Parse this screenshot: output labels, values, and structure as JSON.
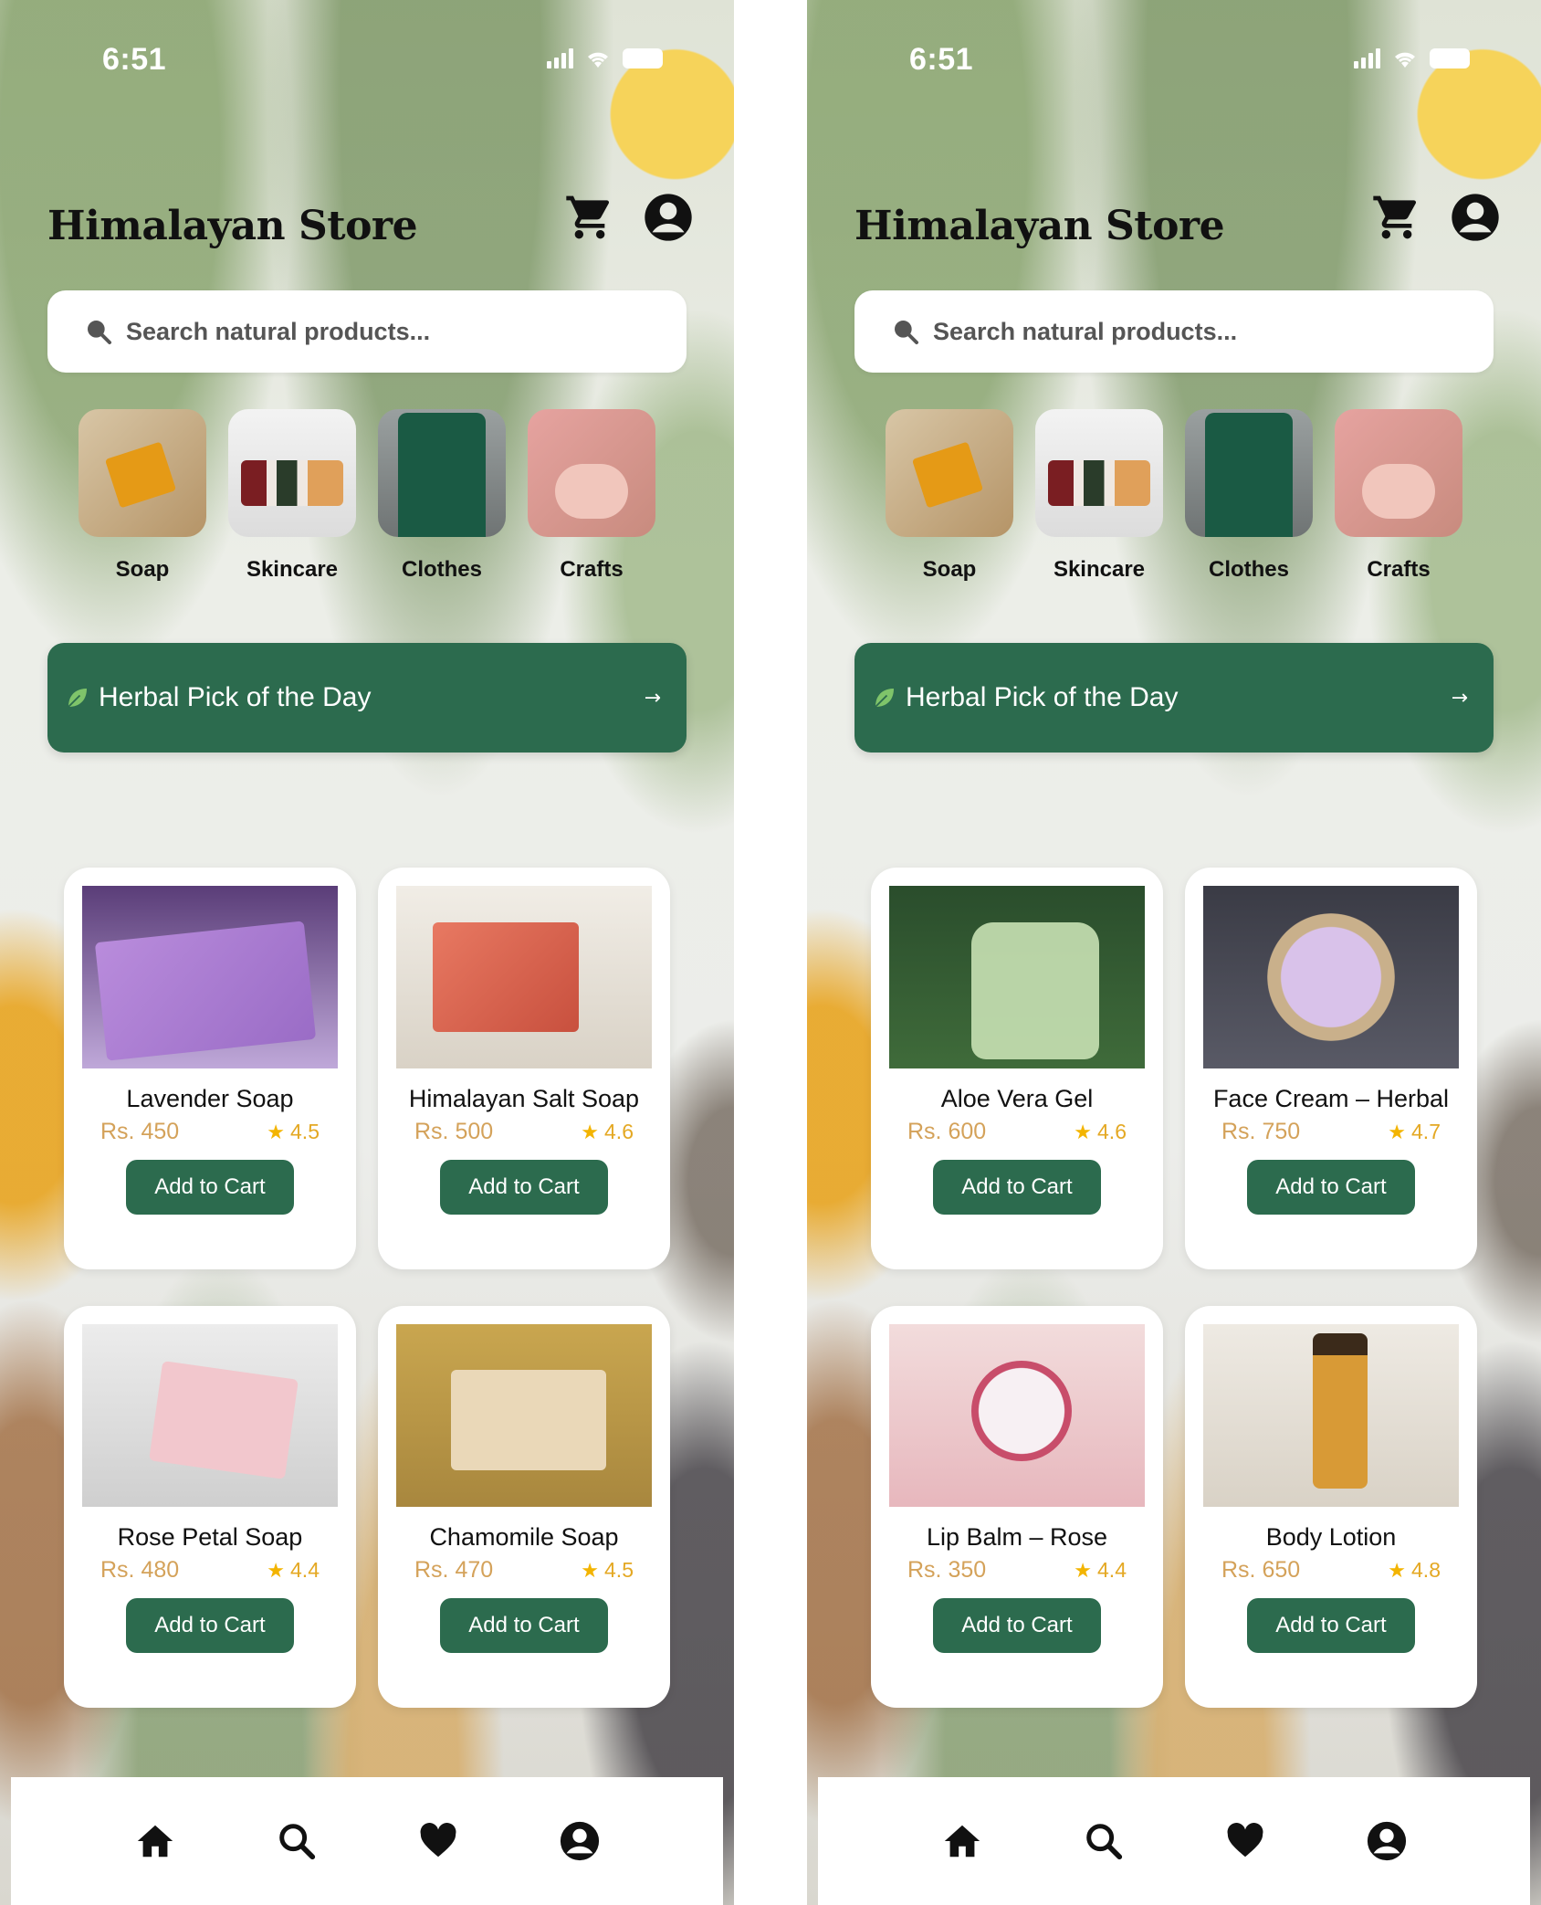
{
  "screens": [
    {
      "status": {
        "time": "6:51"
      },
      "header": {
        "title": "Himalayan Store"
      },
      "search": {
        "placeholder": "Search natural products..."
      },
      "categories": [
        {
          "label": "Soap"
        },
        {
          "label": "Skincare"
        },
        {
          "label": "Clothes"
        },
        {
          "label": "Crafts"
        }
      ],
      "pick_banner": {
        "label": "Herbal Pick of the Day",
        "arrow": "→"
      },
      "products": [
        {
          "name": "Lavender Soap",
          "price": "Rs. 450",
          "rating": "4.5",
          "button": "Add to Cart"
        },
        {
          "name": "Himalayan Salt Soap",
          "price": "Rs. 500",
          "rating": "4.6",
          "button": "Add to Cart"
        },
        {
          "name": "Rose Petal Soap",
          "price": "Rs. 480",
          "rating": "4.4",
          "button": "Add to Cart"
        },
        {
          "name": "Chamomile Soap",
          "price": "Rs. 470",
          "rating": "4.5",
          "button": "Add to Cart"
        }
      ]
    },
    {
      "status": {
        "time": "6:51"
      },
      "header": {
        "title": "Himalayan Store"
      },
      "search": {
        "placeholder": "Search natural products..."
      },
      "categories": [
        {
          "label": "Soap"
        },
        {
          "label": "Skincare"
        },
        {
          "label": "Clothes"
        },
        {
          "label": "Crafts"
        }
      ],
      "pick_banner": {
        "label": "Herbal Pick of the Day",
        "arrow": "→"
      },
      "products": [
        {
          "name": "Aloe Vera Gel",
          "price": "Rs. 600",
          "rating": "4.6",
          "button": "Add to Cart"
        },
        {
          "name": "Face Cream – Herbal",
          "price": "Rs. 750",
          "rating": "4.7",
          "button": "Add to Cart"
        },
        {
          "name": "Lip Balm – Rose",
          "price": "Rs. 350",
          "rating": "4.4",
          "button": "Add to Cart"
        },
        {
          "name": "Body Lotion",
          "price": "Rs. 650",
          "rating": "4.8",
          "button": "Add to Cart"
        }
      ]
    }
  ],
  "icons": {
    "status": [
      "signal-icon",
      "wifi-icon",
      "battery-icon"
    ],
    "header": [
      "cart-icon",
      "account-icon"
    ],
    "search": "search-icon",
    "banner": "leaf-icon",
    "rating": "star-icon",
    "bottom_nav": [
      "home-icon",
      "search-icon",
      "heart-icon",
      "profile-icon"
    ]
  },
  "colors": {
    "primary_green": "#2c6b4e",
    "price_tan": "#d4a25a",
    "star_gold": "#f3b400",
    "card_bg": "#ffffff"
  }
}
